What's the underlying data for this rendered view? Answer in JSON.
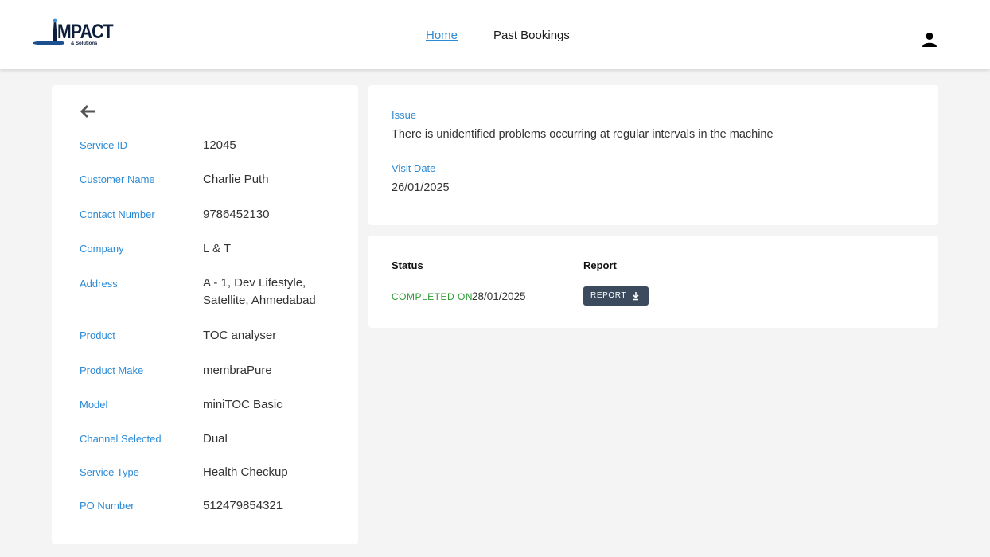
{
  "header": {
    "logo_text": "MPACT",
    "logo_subtext": "& Solutions",
    "nav": {
      "home": "Home",
      "past_bookings": "Past Bookings"
    },
    "icons": {
      "user": "user-icon"
    }
  },
  "details": {
    "back_icon": "arrow-left-icon",
    "fields": [
      {
        "label": "Service ID",
        "value": "12045"
      },
      {
        "label": "Customer Name",
        "value": "Charlie Puth"
      },
      {
        "label": "Contact Number",
        "value": "9786452130"
      },
      {
        "label": "Company",
        "value": "L & T"
      },
      {
        "label": "Address",
        "value": "A - 1, Dev Lifestyle, Satellite, Ahmedabad"
      },
      {
        "label": "Product",
        "value": "TOC analyser"
      },
      {
        "label": "Product Make",
        "value": "membraPure"
      },
      {
        "label": "Model",
        "value": "miniTOC Basic"
      },
      {
        "label": "Channel Selected",
        "value": "Dual"
      },
      {
        "label": "Service Type",
        "value": "Health Checkup"
      },
      {
        "label": "PO Number",
        "value": "512479854321"
      }
    ]
  },
  "issue": {
    "issue_label": "Issue",
    "issue_text": "There is unidentified problems occurring at regular intervals in the machine",
    "visit_label": "Visit Date",
    "visit_date": "26/01/2025"
  },
  "status": {
    "status_heading": "Status",
    "report_heading": "Report",
    "completed_label": "COMPLETED ON",
    "completed_date": "28/01/2025",
    "report_button": "REPORT",
    "download_icon": "download-icon"
  },
  "colors": {
    "accent": "#2d8bd6",
    "success": "#2e9b34",
    "button": "#3b4a5c",
    "background": "#f4f4f4"
  }
}
